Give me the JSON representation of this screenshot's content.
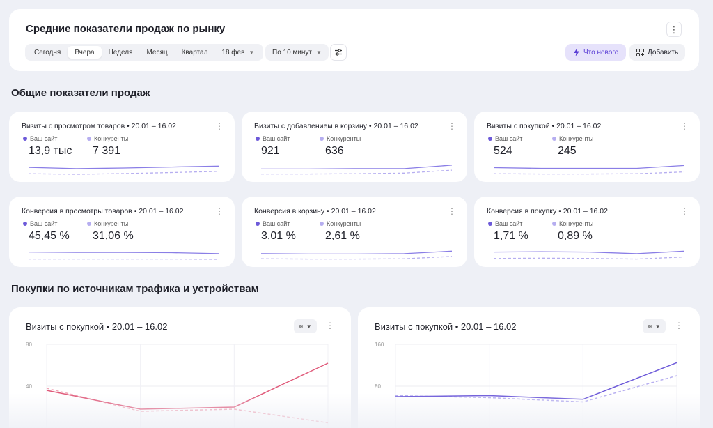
{
  "header": {
    "title": "Средние показатели продаж по рынку",
    "more_icon": "more-vertical-icon",
    "periods": [
      {
        "label": "Сегодня",
        "active": false
      },
      {
        "label": "Вчера",
        "active": true
      },
      {
        "label": "Неделя",
        "active": false
      },
      {
        "label": "Месяц",
        "active": false
      },
      {
        "label": "Квартал",
        "active": false
      },
      {
        "label": "18 фев",
        "active": false
      }
    ],
    "interval": "По 10 минут",
    "whats_new": "Что нового",
    "add": "Добавить",
    "accent_color": "#5b3fd6"
  },
  "sections": {
    "general": "Общие показатели продаж",
    "traffic": "Покупки по источникам трафика и устройствам"
  },
  "legend": {
    "site": "Ваш сайт",
    "competitors": "Конкуренты",
    "site_color": "#6d5ad9",
    "competitors_color": "#b6aef0"
  },
  "metrics": [
    {
      "title": "Визиты с просмотром товаров • 20.01 – 16.02",
      "site": "13,9 тыс",
      "competitors": "7 391",
      "site_line": [
        0.55,
        0.35,
        0.45,
        0.6,
        0.75
      ],
      "comp_line": [
        0.1,
        0.0,
        0.12,
        0.3,
        0.5
      ]
    },
    {
      "title": "Визиты с добавлением в корзину • 20.01 – 16.02",
      "site": "921",
      "competitors": "636",
      "site_line": [
        0.3,
        0.3,
        0.35,
        0.35,
        0.9
      ],
      "comp_line": [
        0.05,
        0.05,
        0.1,
        0.2,
        0.7
      ]
    },
    {
      "title": "Визиты с покупкой • 20.01 – 16.02",
      "site": "524",
      "competitors": "245",
      "site_line": [
        0.5,
        0.4,
        0.4,
        0.4,
        0.85
      ],
      "comp_line": [
        0.1,
        0.05,
        0.05,
        0.1,
        0.4
      ]
    },
    {
      "title": "Конверсия в просмотры товаров • 20.01 – 16.02",
      "site": "45,45 %",
      "competitors": "31,06 %",
      "site_line": [
        0.6,
        0.55,
        0.55,
        0.5,
        0.35
      ],
      "comp_line": [
        0.05,
        0.05,
        0.05,
        0.05,
        0.0
      ]
    },
    {
      "title": "Конверсия в корзину • 20.01 – 16.02",
      "site": "3,01 %",
      "competitors": "2,61 %",
      "site_line": [
        0.35,
        0.3,
        0.3,
        0.35,
        0.75
      ],
      "comp_line": [
        0.1,
        0.05,
        0.05,
        0.1,
        0.5
      ]
    },
    {
      "title": "Конверсия в покупку • 20.01 – 16.02",
      "site": "1,71 %",
      "competitors": "0,89 %",
      "site_line": [
        0.6,
        0.65,
        0.6,
        0.35,
        0.75
      ],
      "comp_line": [
        0.15,
        0.2,
        0.15,
        0.05,
        0.4
      ]
    }
  ],
  "charts": [
    {
      "title": "Визиты с покупкой • 20.01 – 16.02",
      "ylim": [
        0,
        80
      ],
      "ticks": [
        "80",
        "40"
      ],
      "site": [
        36,
        18,
        20,
        62
      ],
      "comp": [
        38,
        16,
        18,
        5
      ],
      "site_color": "#e05a7a",
      "comp_color": "#f0a4b5"
    },
    {
      "title": "Визиты с покупкой • 20.01 – 16.02",
      "ylim": [
        0,
        160
      ],
      "ticks": [
        "160",
        "80"
      ],
      "site": [
        60,
        62,
        55,
        125
      ],
      "comp": [
        62,
        58,
        50,
        100
      ],
      "site_color": "#6d5ad9",
      "comp_color": "#b6aef0"
    }
  ]
}
